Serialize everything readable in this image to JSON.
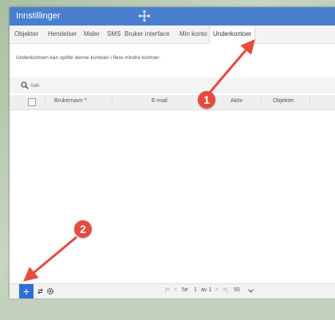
{
  "window": {
    "title": "Innstillinger"
  },
  "tabs": [
    {
      "label": "Objekter"
    },
    {
      "label": "Hendelser"
    },
    {
      "label": "Maler"
    },
    {
      "label": "SMS"
    },
    {
      "label": "Bruker interface"
    },
    {
      "label": "Min konto"
    },
    {
      "label": "Underkontoer",
      "active": true
    }
  ],
  "info_text": "Underkontoen kan splitte denne kontoen i flere mindre kontoer.",
  "search": {
    "placeholder": "Søk"
  },
  "table": {
    "columns": [
      "Brukernavn ^",
      "E-mail",
      "Aktiv",
      "Objekter"
    ]
  },
  "footer": {
    "add_label": "+",
    "pager": {
      "page_size": "5e",
      "page": "1",
      "of": "av 1",
      "per_page": "50"
    }
  },
  "annotations": [
    {
      "label": "1"
    },
    {
      "label": "2"
    }
  ],
  "colors": {
    "titlebar": "#4a7fd0",
    "accent": "#2f6ed8",
    "annotation": "#e84a3c"
  },
  "icons": [
    "move-icon",
    "search-icon",
    "add-icon",
    "refresh-icon",
    "settings-icon",
    "first-page-icon",
    "prev-page-icon",
    "next-page-icon",
    "last-page-icon",
    "chevron-down-icon",
    "arrow-icon"
  ]
}
